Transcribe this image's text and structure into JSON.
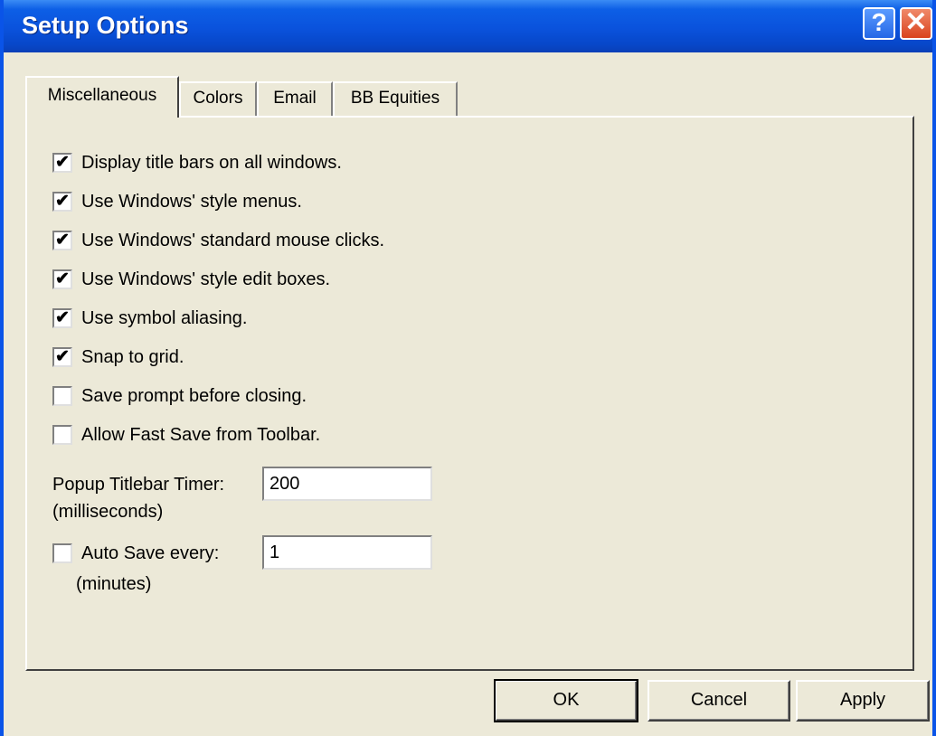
{
  "window": {
    "title": "Setup Options"
  },
  "titlebar": {
    "help_label": "?",
    "close_label": "✕"
  },
  "tabs": [
    {
      "label": "Miscellaneous",
      "active": true
    },
    {
      "label": "Colors",
      "active": false
    },
    {
      "label": "Email",
      "active": false
    },
    {
      "label": "BB Equities",
      "active": false
    }
  ],
  "options": [
    {
      "label": "Display title bars on all windows.",
      "checked": true
    },
    {
      "label": "Use Windows' style menus.",
      "checked": true
    },
    {
      "label": "Use Windows' standard mouse clicks.",
      "checked": true
    },
    {
      "label": "Use Windows' style edit boxes.",
      "checked": true
    },
    {
      "label": "Use symbol aliasing.",
      "checked": true
    },
    {
      "label": "Snap to grid.",
      "checked": true
    },
    {
      "label": "Save prompt before closing.",
      "checked": false
    },
    {
      "label": "Allow Fast Save from Toolbar.",
      "checked": false
    }
  ],
  "popup_timer": {
    "label": "Popup Titlebar Timer:",
    "unit": "(milliseconds)",
    "value": "200"
  },
  "auto_save": {
    "label": "Auto Save every:",
    "unit": "(minutes)",
    "value": "1",
    "checked": false
  },
  "buttons": {
    "ok": "OK",
    "cancel": "Cancel",
    "apply": "Apply"
  }
}
